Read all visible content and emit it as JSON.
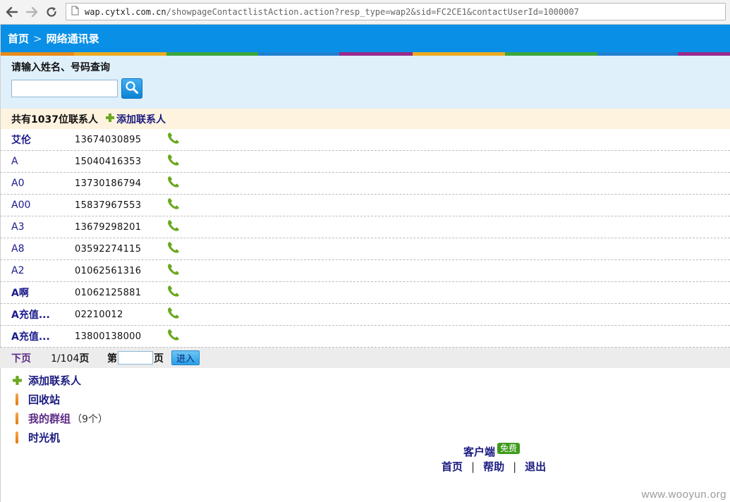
{
  "browser": {
    "url_host": "wap.cytxl.com.cn",
    "url_path": "/showpageContactlistAction.action?resp_type=wap2&sid=FC2CE1&contactUserId=1000007"
  },
  "header": {
    "home": "首页",
    "separator": ">",
    "title": "网络通讯录",
    "stripe_colors": [
      "#e88a1b",
      "#ecab20",
      "#3aa63a",
      "#1f7fd0",
      "#9a2a8c",
      "#ecab20",
      "#3aa63a",
      "#1f7fd0",
      "#9a2a8c"
    ]
  },
  "search": {
    "title": "请输入姓名、号码查询",
    "input_value": ""
  },
  "summary": {
    "text": "共有1037位联系人",
    "add_label": "添加联系人"
  },
  "contacts": [
    {
      "name": "艾伦",
      "phone": "13674030895"
    },
    {
      "name": "A",
      "phone": "15040416353"
    },
    {
      "name": "A0",
      "phone": "13730186794"
    },
    {
      "name": "A00",
      "phone": "15837967553"
    },
    {
      "name": "A3",
      "phone": "13679298201"
    },
    {
      "name": "A8",
      "phone": "03592274115"
    },
    {
      "name": "A2",
      "phone": "01062561316"
    },
    {
      "name": "A啊",
      "phone": "01062125881"
    },
    {
      "name": "A充值...",
      "phone": "02210012"
    },
    {
      "name": "A充值...",
      "phone": "13800138000"
    }
  ],
  "pager": {
    "next": "下页",
    "current": "1/104",
    "unit": "页",
    "goto_prefix": "第",
    "goto_suffix": "页",
    "page_input_value": "",
    "go_button": "进入"
  },
  "links": {
    "add_contact": "添加联系人",
    "recycle_bin": "回收站",
    "my_groups": "我的群组",
    "my_groups_count": "（9个）",
    "time_machine": "时光机"
  },
  "footer": {
    "client": "客户端",
    "free_badge": "免费",
    "home": "首页",
    "help": "帮助",
    "logout": "退出",
    "sep": "|"
  },
  "watermark": "www.wooyun.org",
  "icons": {
    "back": "back-arrow-icon",
    "forward": "forward-arrow-icon",
    "reload": "reload-icon",
    "page": "page-icon",
    "search": "search-icon",
    "plus": "plus-icon",
    "phone": "phone-icon"
  },
  "colors": {
    "header_blue": "#0a8fe6",
    "search_bg": "#dff0fb",
    "summary_bg": "#fdf3de",
    "link_blue": "#1a1a80",
    "visited_purple": "#5c2a86",
    "phone_green": "#6aa81f",
    "free_green": "#3f9a1c"
  }
}
